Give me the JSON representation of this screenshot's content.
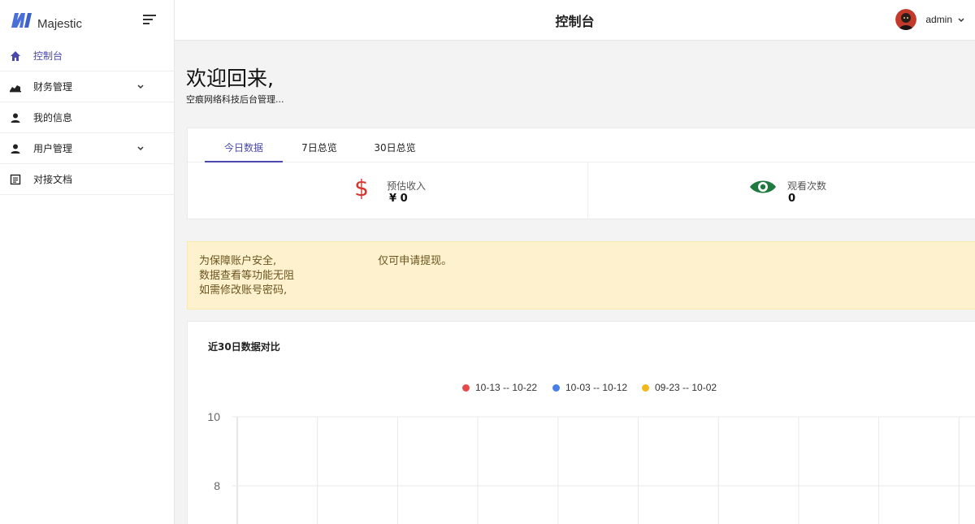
{
  "brand": {
    "name": "Majestic"
  },
  "sidebar": {
    "items": [
      {
        "label": "控制台",
        "icon": "home-icon",
        "active": true,
        "has_submenu": false
      },
      {
        "label": "财务管理",
        "icon": "chart-area-icon",
        "active": false,
        "has_submenu": true
      },
      {
        "label": "我的信息",
        "icon": "user-icon",
        "active": false,
        "has_submenu": false
      },
      {
        "label": "用户管理",
        "icon": "user-icon",
        "active": false,
        "has_submenu": true
      },
      {
        "label": "对接文档",
        "icon": "document-icon",
        "active": false,
        "has_submenu": false
      }
    ]
  },
  "header": {
    "title": "控制台",
    "user_name": "admin"
  },
  "welcome": {
    "title": "欢迎回来,",
    "subtitle": "空痕网络科技后台管理..."
  },
  "stats": {
    "tabs": [
      "今日数据",
      "7日总览",
      "30日总览"
    ],
    "active_tab": 0,
    "items": [
      {
        "label": "预估收入",
        "value": "¥ 0",
        "icon": "dollar-icon"
      },
      {
        "label": "观看次数",
        "value": "0",
        "icon": "eye-icon"
      }
    ]
  },
  "alert": {
    "lines": [
      "为保障账户安全,",
      "仅可申请提现。",
      "数据查看等功能无阻",
      "如需修改账号密码,"
    ]
  },
  "colors": {
    "accent": "#4b49ac",
    "series_red": "#e84a4a",
    "series_blue": "#4a7ee8",
    "series_yellow": "#f2b91c",
    "dollar": "#d9342b",
    "eye": "#1f7a3f"
  },
  "chart_data": {
    "type": "line",
    "title": "近30日数据对比",
    "legend_position": "top-center",
    "series": [
      {
        "name": "10-13 -- 10-22",
        "color": "#e84a4a",
        "values": []
      },
      {
        "name": "10-03 -- 10-12",
        "color": "#4a7ee8",
        "values": []
      },
      {
        "name": "09-23 -- 10-02",
        "color": "#f2b91c",
        "values": []
      }
    ],
    "y_ticks": [
      10,
      8
    ],
    "grid": true
  }
}
